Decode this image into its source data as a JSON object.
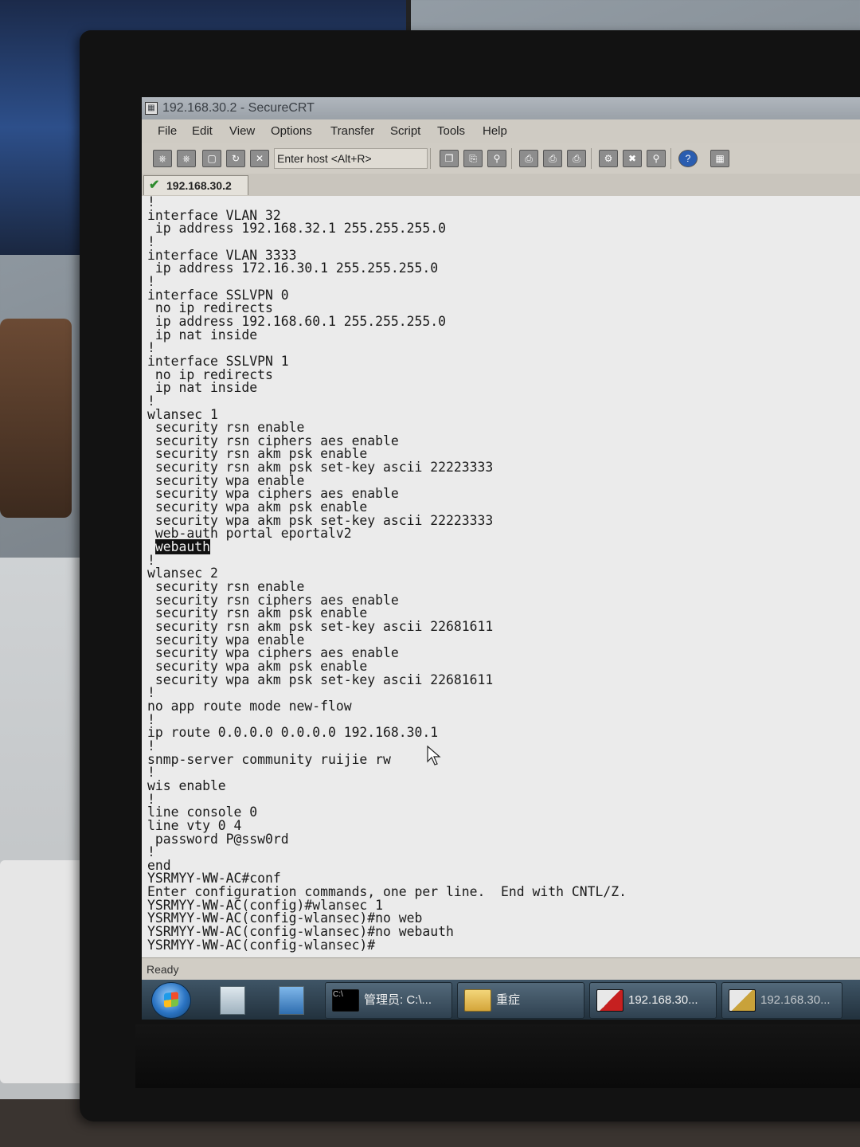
{
  "window": {
    "title": "192.168.30.2 - SecureCRT"
  },
  "menu": [
    "File",
    "Edit",
    "View",
    "Options",
    "Transfer",
    "Script",
    "Tools",
    "Help"
  ],
  "toolbar": {
    "host_placeholder": "Enter host <Alt+R>"
  },
  "session_tab": {
    "label": "192.168.30.2",
    "status_icon": "check-icon",
    "status_color": "#2e8b2e"
  },
  "terminal": {
    "lines": [
      "!",
      "interface VLAN 32",
      " ip address 192.168.32.1 255.255.255.0",
      "!",
      "interface VLAN 3333",
      " ip address 172.16.30.1 255.255.255.0",
      "!",
      "interface SSLVPN 0",
      " no ip redirects",
      " ip address 192.168.60.1 255.255.255.0",
      " ip nat inside",
      "!",
      "interface SSLVPN 1",
      " no ip redirects",
      " ip nat inside",
      "!",
      "wlansec 1",
      " security rsn enable",
      " security rsn ciphers aes enable",
      " security rsn akm psk enable",
      " security rsn akm psk set-key ascii 22223333",
      " security wpa enable",
      " security wpa ciphers aes enable",
      " security wpa akm psk enable",
      " security wpa akm psk set-key ascii 22223333",
      " web-auth portal eportalv2",
      " webauth",
      "!",
      "wlansec 2",
      " security rsn enable",
      " security rsn ciphers aes enable",
      " security rsn akm psk enable",
      " security rsn akm psk set-key ascii 22681611",
      " security wpa enable",
      " security wpa ciphers aes enable",
      " security wpa akm psk enable",
      " security wpa akm psk set-key ascii 22681611",
      "!",
      "no app route mode new-flow",
      "!",
      "ip route 0.0.0.0 0.0.0.0 192.168.30.1",
      "!",
      "snmp-server community ruijie rw",
      "!",
      "wis enable",
      "!",
      "line console 0",
      "line vty 0 4",
      " password P@ssw0rd",
      "!",
      "end",
      "YSRMYY-WW-AC#conf",
      "Enter configuration commands, one per line.  End with CNTL/Z.",
      "YSRMYY-WW-AC(config)#wlansec 1",
      "YSRMYY-WW-AC(config-wlansec)#no web",
      "YSRMYY-WW-AC(config-wlansec)#no webauth",
      "YSRMYY-WW-AC(config-wlansec)#"
    ],
    "highlighted_line_index": 26,
    "highlight_text": "webauth"
  },
  "status": {
    "text": "Ready"
  },
  "taskbar": {
    "items": [
      {
        "label": "管理员: C:\\...",
        "icon": "cmd-icon"
      },
      {
        "label": "重症",
        "icon": "folder-icon"
      },
      {
        "label": "192.168.30...",
        "icon": "securecrt-icon"
      },
      {
        "label": "192.168.30...",
        "icon": "securecrt-icon"
      }
    ]
  }
}
